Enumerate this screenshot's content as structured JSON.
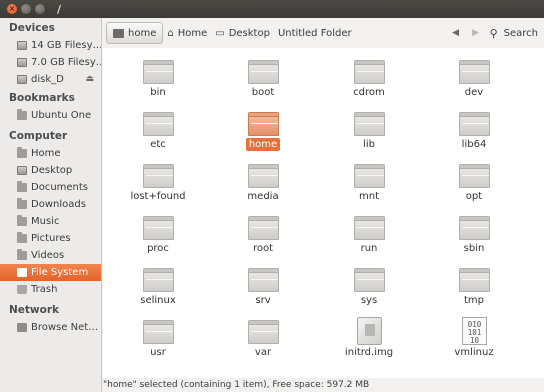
{
  "window": {
    "title": "/"
  },
  "sidebar": {
    "sections": [
      {
        "heading": "Devices",
        "items": [
          {
            "label": "14 GB Filesy…",
            "icon": "drive-icon"
          },
          {
            "label": "7.0 GB Filesy…",
            "icon": "drive-icon"
          },
          {
            "label": "disk_D",
            "icon": "drive-icon",
            "eject": "⏏"
          }
        ]
      },
      {
        "heading": "Bookmarks",
        "items": [
          {
            "label": "Ubuntu One",
            "icon": "folder-icon"
          }
        ]
      },
      {
        "heading": "Computer",
        "items": [
          {
            "label": "Home",
            "icon": "home-icon"
          },
          {
            "label": "Desktop",
            "icon": "desktop-icon"
          },
          {
            "label": "Documents",
            "icon": "folder-icon"
          },
          {
            "label": "Downloads",
            "icon": "folder-icon"
          },
          {
            "label": "Music",
            "icon": "folder-icon"
          },
          {
            "label": "Pictures",
            "icon": "folder-icon"
          },
          {
            "label": "Videos",
            "icon": "folder-icon"
          },
          {
            "label": "File System",
            "icon": "filesystem-icon",
            "selected": true
          },
          {
            "label": "Trash",
            "icon": "trash-icon"
          }
        ]
      },
      {
        "heading": "Network",
        "items": [
          {
            "label": "Browse Net…",
            "icon": "network-icon"
          }
        ]
      }
    ]
  },
  "toolbar": {
    "breadcrumbs": [
      "home",
      "Home",
      "Desktop",
      "Untitled Folder"
    ],
    "search_label": "Search"
  },
  "files": [
    {
      "name": "bin",
      "type": "folder"
    },
    {
      "name": "boot",
      "type": "folder"
    },
    {
      "name": "cdrom",
      "type": "folder"
    },
    {
      "name": "dev",
      "type": "folder"
    },
    {
      "name": "etc",
      "type": "folder"
    },
    {
      "name": "home",
      "type": "folder",
      "selected": true
    },
    {
      "name": "lib",
      "type": "folder"
    },
    {
      "name": "lib64",
      "type": "folder"
    },
    {
      "name": "lost+found",
      "type": "folder"
    },
    {
      "name": "media",
      "type": "folder"
    },
    {
      "name": "mnt",
      "type": "folder"
    },
    {
      "name": "opt",
      "type": "folder"
    },
    {
      "name": "proc",
      "type": "folder"
    },
    {
      "name": "root",
      "type": "folder"
    },
    {
      "name": "run",
      "type": "folder"
    },
    {
      "name": "sbin",
      "type": "folder"
    },
    {
      "name": "selinux",
      "type": "folder"
    },
    {
      "name": "srv",
      "type": "folder"
    },
    {
      "name": "sys",
      "type": "folder"
    },
    {
      "name": "tmp",
      "type": "folder"
    },
    {
      "name": "usr",
      "type": "folder"
    },
    {
      "name": "var",
      "type": "folder"
    },
    {
      "name": "initrd.img",
      "type": "package"
    },
    {
      "name": "vmlinuz",
      "type": "binary",
      "glyph": "010\n101\n10"
    }
  ],
  "status": "\"home\" selected (containing 1 item), Free space: 597.2 MB",
  "colors": {
    "accent": "#e8703a",
    "titlebar": "#3c3b37",
    "sidebar": "#edebe9"
  }
}
